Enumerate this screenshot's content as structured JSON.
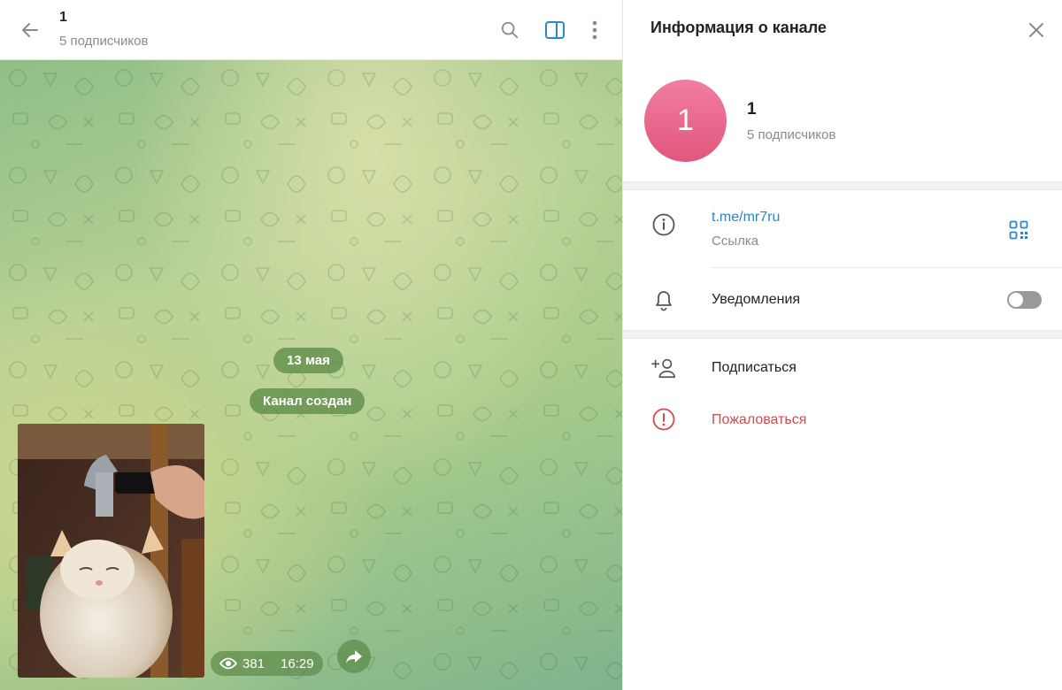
{
  "chat": {
    "title": "1",
    "subtitle": "5 подписчиков",
    "date_badge": "13 мая",
    "service_message": "Канал создан",
    "post": {
      "views": "381",
      "time": "16:29"
    }
  },
  "info_panel": {
    "title": "Информация о канале",
    "avatar_letter": "1",
    "name": "1",
    "subscribers": "5 подписчиков",
    "link": "t.me/mr7ru",
    "link_caption": "Ссылка",
    "notifications_label": "Уведомления",
    "notifications_enabled": false,
    "subscribe_label": "Подписаться",
    "report_label": "Пожаловаться"
  },
  "colors": {
    "accent": "#2a87c8",
    "avatar_pink": "#e2567d",
    "danger": "#d14b4b",
    "chat_bubble_green": "#5e8c4a"
  },
  "icons": [
    "back-arrow-icon",
    "search-icon",
    "sidebar-toggle-icon",
    "more-vertical-icon",
    "close-icon",
    "info-icon",
    "qr-code-icon",
    "bell-icon",
    "add-user-icon",
    "report-icon",
    "eye-icon",
    "share-icon"
  ]
}
